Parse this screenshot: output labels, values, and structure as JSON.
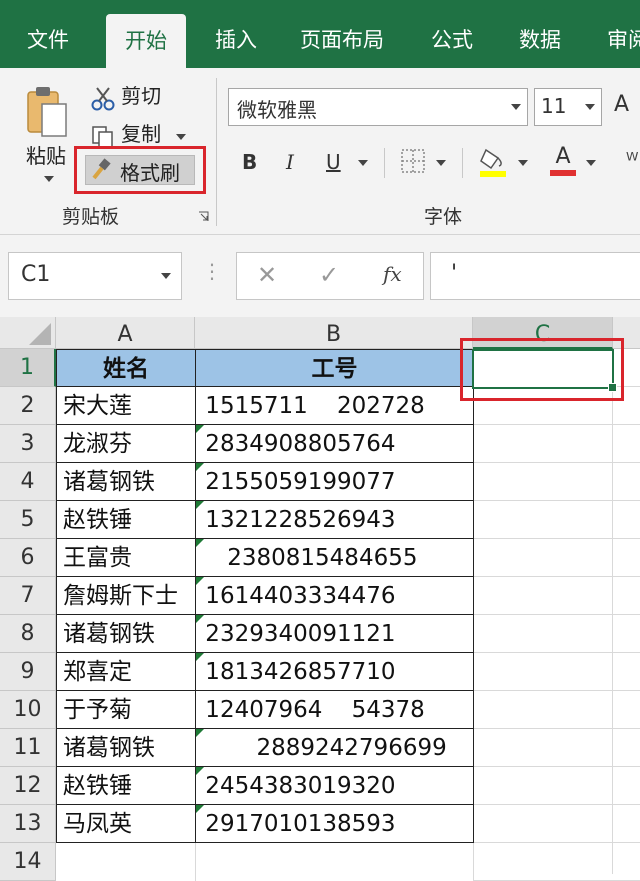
{
  "ribbon_tabs": [
    {
      "label": "文件",
      "active": false
    },
    {
      "label": "开始",
      "active": true
    },
    {
      "label": "插入",
      "active": false
    },
    {
      "label": "页面布局",
      "active": false
    },
    {
      "label": "公式",
      "active": false
    },
    {
      "label": "数据",
      "active": false
    },
    {
      "label": "审阅",
      "active": false
    }
  ],
  "clipboard": {
    "paste": "粘贴",
    "cut": "剪切",
    "copy": "复制",
    "format_painter": "格式刷",
    "group_label": "剪贴板"
  },
  "font": {
    "name": "微软雅黑",
    "size": "11",
    "bold": "B",
    "italic": "I",
    "underline": "U",
    "group_label": "字体"
  },
  "formula_bar": {
    "name_box": "C1",
    "fx": "fx",
    "content": "'"
  },
  "colors": {
    "accent": "#1f7244",
    "highlight": "#d9252c",
    "header_fill": "#9dc3e6",
    "fill_color": "#ffff00",
    "font_color": "#e03131"
  },
  "sheet": {
    "columns": [
      "A",
      "B",
      "C"
    ],
    "rows": [
      "1",
      "2",
      "3",
      "4",
      "5",
      "6",
      "7",
      "8",
      "9",
      "10",
      "11",
      "12",
      "13",
      "14"
    ],
    "header": {
      "name": "姓名",
      "id": "工号"
    },
    "data": [
      {
        "name": "宋大莲",
        "id": " 1515711    202728",
        "flag": false
      },
      {
        "name": "龙淑芬",
        "id": " 2834908805764",
        "flag": true
      },
      {
        "name": "诸葛钢铁",
        "id": " 2155059199077",
        "flag": true
      },
      {
        "name": "赵铁锤",
        "id": " 1321228526943",
        "flag": true
      },
      {
        "name": "王富贵",
        "id": "    2380815484655",
        "flag": true
      },
      {
        "name": "詹姆斯下士",
        "id": " 1614403334476",
        "flag": true
      },
      {
        "name": "诸葛钢铁",
        "id": " 2329340091121",
        "flag": true
      },
      {
        "name": "郑喜定",
        "id": " 1813426857710",
        "flag": true
      },
      {
        "name": "于予菊",
        "id": " 12407964    54378",
        "flag": false
      },
      {
        "name": "诸葛钢铁",
        "id": "        2889242796699",
        "flag": true
      },
      {
        "name": "赵铁锤",
        "id": " 2454383019320",
        "flag": true
      },
      {
        "name": "马凤英",
        "id": " 2917010138593",
        "flag": true
      }
    ]
  }
}
